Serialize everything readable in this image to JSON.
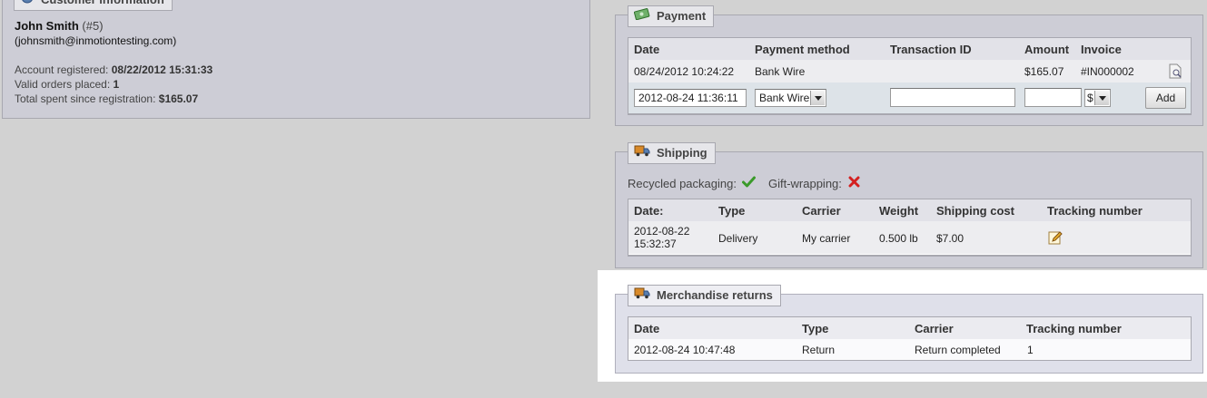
{
  "customer": {
    "legend": "Customer information",
    "name": "John Smith",
    "id": "(#5)",
    "email_open": "(",
    "email": "johnsmith@inmotiontesting.com",
    "email_close": ")",
    "account_registered_label": "Account registered:",
    "account_registered_value": "08/22/2012 15:31:33",
    "valid_orders_label": "Valid orders placed:",
    "valid_orders_value": "1",
    "total_spent_label": "Total spent since registration:",
    "total_spent_value": "$165.07"
  },
  "payment": {
    "legend": "Payment",
    "columns": [
      "Date",
      "Payment method",
      "Transaction ID",
      "Amount",
      "Invoice"
    ],
    "rows": [
      {
        "date": "08/24/2012 10:24:22",
        "method": "Bank Wire",
        "transaction_id": "",
        "amount": "$165.07",
        "invoice": "#IN000002"
      }
    ],
    "form": {
      "date_value": "2012-08-24 11:36:11",
      "method_value": "Bank Wire",
      "transaction_value": "",
      "amount_value": "",
      "currency_value": "$",
      "add_label": "Add"
    }
  },
  "shipping": {
    "legend": "Shipping",
    "recycled_label": "Recycled packaging:",
    "gift_label": "Gift-wrapping:",
    "columns": [
      "Date:",
      "Type",
      "Carrier",
      "Weight",
      "Shipping cost",
      "Tracking number"
    ],
    "rows": [
      {
        "date_line1": "2012-08-22",
        "date_line2": "15:32:37",
        "type": "Delivery",
        "carrier": "My carrier",
        "weight": "0.500 lb",
        "cost": "$7.00"
      }
    ]
  },
  "returns": {
    "legend": "Merchandise returns",
    "columns": [
      "Date",
      "Type",
      "Carrier",
      "Tracking number"
    ],
    "rows": [
      {
        "date": "2012-08-24 10:47:48",
        "type": "Return",
        "carrier": "Return completed",
        "tracking": "1"
      }
    ]
  },
  "colors": {
    "check": "#3a9a2a",
    "cross": "#d42020",
    "highlight": "#ffffff"
  },
  "icons": {
    "customer": "user-icon",
    "payment": "money-icon",
    "shipping": "truck-icon",
    "returns": "truck-icon",
    "invoice": "document-icon",
    "tracking_edit": "pencil-icon",
    "recycled": "check-icon",
    "gift": "cross-icon"
  }
}
